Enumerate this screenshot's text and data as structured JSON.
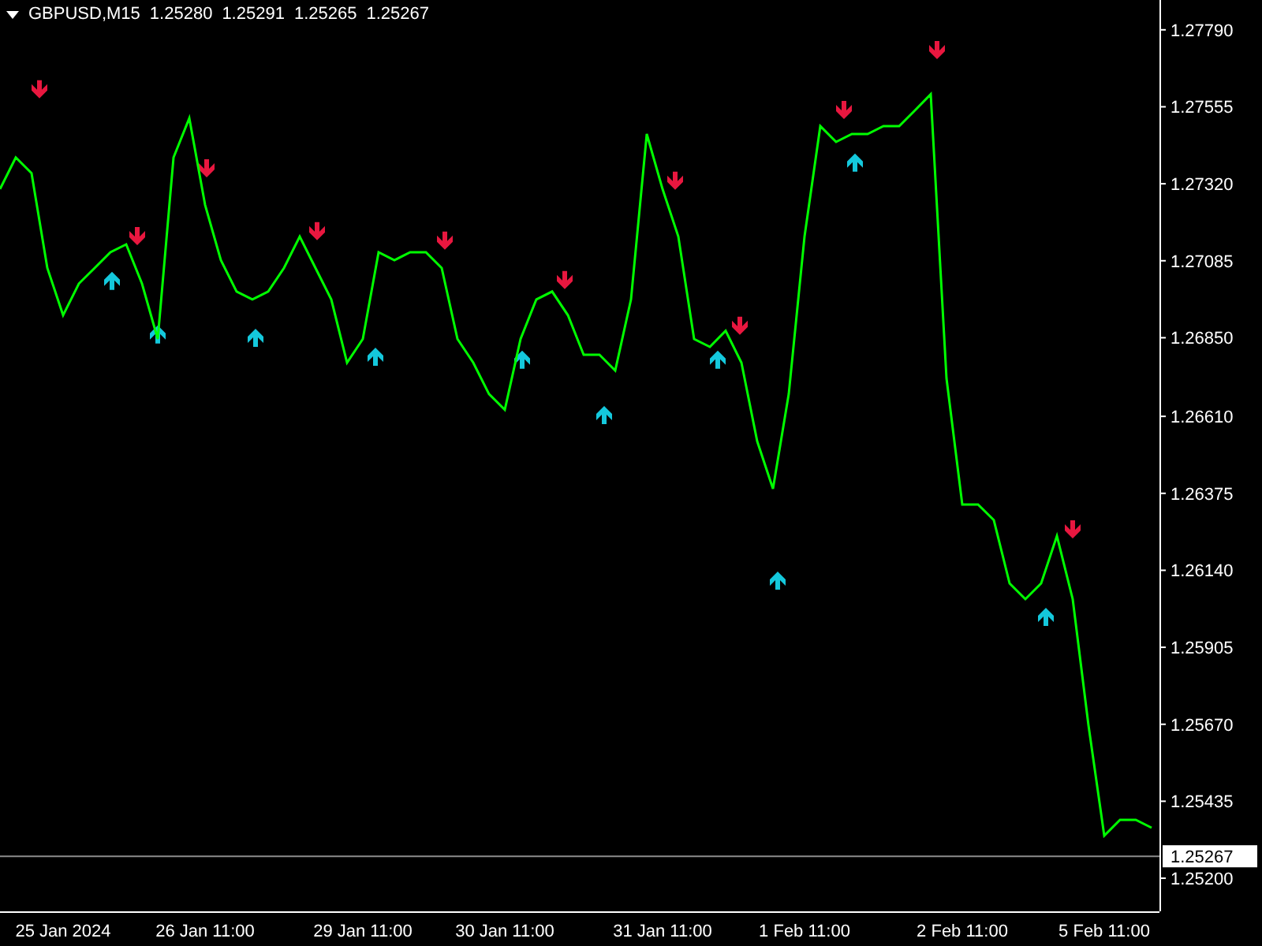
{
  "header": {
    "symbol": "GBPUSD,M15",
    "prices": [
      "1.25280",
      "1.25291",
      "1.25265",
      "1.25267"
    ]
  },
  "chart_data": {
    "type": "line",
    "categories": [
      null,
      null,
      null,
      null,
      "25 Jan 2024",
      null,
      null,
      null,
      null,
      null,
      null,
      null,
      null,
      "26 Jan 11:00",
      null,
      null,
      null,
      null,
      null,
      null,
      null,
      null,
      null,
      "29 Jan 11:00",
      null,
      null,
      null,
      null,
      null,
      null,
      null,
      null,
      "30 Jan 11:00",
      null,
      null,
      null,
      null,
      null,
      null,
      null,
      null,
      null,
      "31 Jan 11:00",
      null,
      null,
      null,
      null,
      null,
      null,
      null,
      null,
      "1 Feb 11:00",
      null,
      null,
      null,
      null,
      null,
      null,
      null,
      null,
      null,
      "2 Feb 11:00",
      null,
      null,
      null,
      null,
      null,
      null,
      null,
      null,
      "5 Feb 11:00",
      null,
      null,
      null
    ],
    "series": [
      {
        "color": "#00ff00",
        "values": [
          1.27304,
          1.274,
          1.27352,
          1.27063,
          1.26919,
          1.27015,
          1.27063,
          1.27111,
          1.27135,
          1.27015,
          1.26846,
          1.274,
          1.2752,
          1.27256,
          1.27087,
          1.26991,
          1.26967,
          1.26991,
          1.27063,
          1.27159,
          1.27063,
          1.26967,
          1.26774,
          1.26846,
          1.27111,
          1.27087,
          1.27111,
          1.27111,
          1.27063,
          1.26846,
          1.26774,
          1.26678,
          1.2663,
          1.26846,
          1.26967,
          1.26991,
          1.26919,
          1.26798,
          1.26798,
          1.2675,
          1.26967,
          1.27472,
          1.27304,
          1.27159,
          1.26846,
          1.26822,
          1.26871,
          1.26774,
          1.26534,
          1.26389,
          1.26678,
          1.27159,
          1.27496,
          1.27448,
          1.27472,
          1.27472,
          1.27496,
          1.27496,
          1.27544,
          1.27593,
          1.26726,
          1.26341,
          1.26341,
          1.26293,
          1.261,
          1.26052,
          1.261,
          1.26245,
          1.26052,
          1.25667,
          1.2533,
          1.25378,
          1.25378,
          1.25354
        ]
      }
    ],
    "ylim": [
      1.25099,
      1.27881
    ],
    "yticks": [
      {
        "value": 1.2779,
        "label": "1.27790"
      },
      {
        "value": 1.27555,
        "label": "1.27555"
      },
      {
        "value": 1.2732,
        "label": "1.27320"
      },
      {
        "value": 1.27085,
        "label": "1.27085"
      },
      {
        "value": 1.2685,
        "label": "1.26850"
      },
      {
        "value": 1.2661,
        "label": "1.26610"
      },
      {
        "value": 1.26375,
        "label": "1.26375"
      },
      {
        "value": 1.2614,
        "label": "1.26140"
      },
      {
        "value": 1.25905,
        "label": "1.25905"
      },
      {
        "value": 1.2567,
        "label": "1.25670"
      },
      {
        "value": 1.25435,
        "label": "1.25435"
      },
      {
        "value": 1.252,
        "label": "1.25200"
      }
    ],
    "ref_lines": [
      {
        "axis": "y",
        "value": 1.25267,
        "label": "1.25267"
      }
    ]
  }
}
